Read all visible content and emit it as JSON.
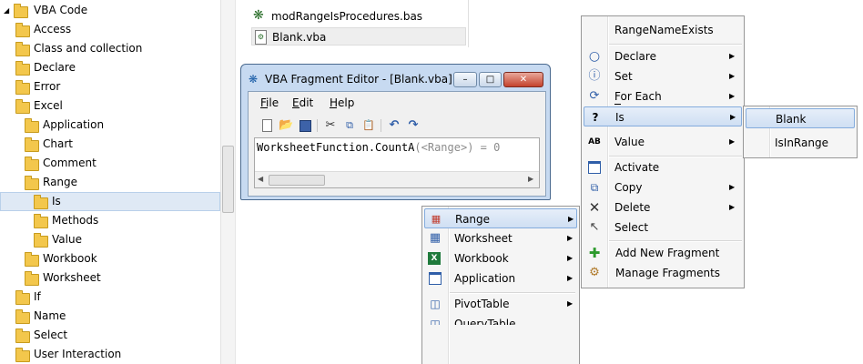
{
  "tree": {
    "items": [
      {
        "label": "VBA Code",
        "level": 0
      },
      {
        "label": "Access",
        "level": 1
      },
      {
        "label": "Class and collection",
        "level": 1
      },
      {
        "label": "Declare",
        "level": 1
      },
      {
        "label": "Error",
        "level": 1
      },
      {
        "label": "Excel",
        "level": 1
      },
      {
        "label": "Application",
        "level": 2
      },
      {
        "label": "Chart",
        "level": 2
      },
      {
        "label": "Comment",
        "level": 2
      },
      {
        "label": "Range",
        "level": 2
      },
      {
        "label": "Is",
        "level": 3,
        "selected": true
      },
      {
        "label": "Methods",
        "level": 3
      },
      {
        "label": "Value",
        "level": 3
      },
      {
        "label": "Workbook",
        "level": 2
      },
      {
        "label": "Worksheet",
        "level": 2
      },
      {
        "label": "If",
        "level": 1
      },
      {
        "label": "Name",
        "level": 1
      },
      {
        "label": "Select",
        "level": 1
      },
      {
        "label": "User Interaction",
        "level": 1
      }
    ]
  },
  "files": [
    {
      "label": "modRangeIsProcedures.bas",
      "icon": "module-icon"
    },
    {
      "label": "Blank.vba",
      "icon": "vba-file-icon",
      "selected": true
    }
  ],
  "editor": {
    "title": "VBA Fragment Editor - [Blank.vba]",
    "menu": [
      "File",
      "Edit",
      "Help"
    ],
    "code": {
      "a": "WorksheetFunction.CountA",
      "b": "(<Range>) = 0"
    },
    "min_label": "–",
    "max_label": "□",
    "close_label": "✕"
  },
  "menu_main": {
    "header": "RangeNameExists",
    "items": [
      {
        "label": "Declare",
        "icon": "circle-icon"
      },
      {
        "label": "Set",
        "icon": "info-icon"
      },
      {
        "label": "For Each",
        "icon": "loop-icon"
      },
      {
        "label": "Is",
        "icon": "question-icon"
      },
      {
        "label": "Value",
        "icon": "ab-icon"
      },
      {
        "label": "Activate",
        "icon": "window-icon"
      },
      {
        "label": "Copy",
        "icon": "copy-icon"
      },
      {
        "label": "Delete",
        "icon": "x-icon"
      },
      {
        "label": "Select",
        "icon": "cursor-icon"
      },
      {
        "label": "Add New Fragment",
        "icon": "plus-icon"
      },
      {
        "label": "Manage Fragments",
        "icon": "manage-icon"
      }
    ]
  },
  "menu_is": {
    "items": [
      "Blank",
      "IsInRange"
    ]
  },
  "menu_objects": {
    "items": [
      {
        "label": "Range",
        "icon": "range-icon"
      },
      {
        "label": "Worksheet",
        "icon": "sheet-icon"
      },
      {
        "label": "Workbook",
        "icon": "excel-icon"
      },
      {
        "label": "Application",
        "icon": "app-window-icon"
      },
      {
        "label": "PivotTable",
        "icon": "pivot-icon"
      },
      {
        "label": "QueryTable",
        "icon": "query-icon"
      }
    ]
  },
  "colors": {
    "accent": "#84acdd",
    "folder": "#f3c74c",
    "code_gray": "#8c8c8c"
  }
}
